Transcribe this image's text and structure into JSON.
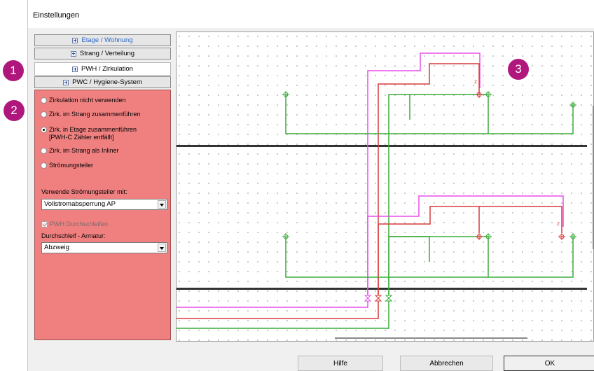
{
  "window": {
    "title": "Einstellungen"
  },
  "tabs": [
    {
      "label": "Etage / Wohnung",
      "active": false
    },
    {
      "label": "Strang / Verteilung",
      "active": false
    },
    {
      "label": "PWH / Zirkulation",
      "active": true
    },
    {
      "label": "PWC / Hygiene-System",
      "active": false
    }
  ],
  "options": [
    {
      "label": "Zirkulation nicht verwenden",
      "selected": false
    },
    {
      "label": "Zirk. im Strang zusammenführen",
      "selected": false
    },
    {
      "label": "Zirk. in Etage zusammenführen",
      "note": "[PWH-C Zähler entfällt]",
      "selected": true
    },
    {
      "label": "Zirk. im Strang als Inliner",
      "selected": false
    },
    {
      "label": "Strömungsteiler",
      "selected": false
    }
  ],
  "flow_divider": {
    "label": "Verwende Strömungsteiler mit:",
    "value": "Vollstromabsperrung AP"
  },
  "pwh_loop": {
    "label": "PWH Durchschleifen",
    "checked": true,
    "disabled": true
  },
  "loop_fitting": {
    "label": "Durchschleif - Armatur:",
    "value": "Abzweig"
  },
  "badges": [
    "1",
    "2",
    "3"
  ],
  "buttons": {
    "help": "Hilfe",
    "cancel": "Abbrechen",
    "ok": "OK"
  },
  "diagram_labels": {
    "valve_mark": "Z"
  },
  "colors": {
    "panel": "#f08080",
    "badge": "#b0177d",
    "pipe_pwh": "#d93a3a",
    "pipe_circ": "#e84ee8",
    "pipe_pwc": "#3aab3a",
    "floor_slab": "#333333",
    "tab_blue": "#2f67c8"
  }
}
